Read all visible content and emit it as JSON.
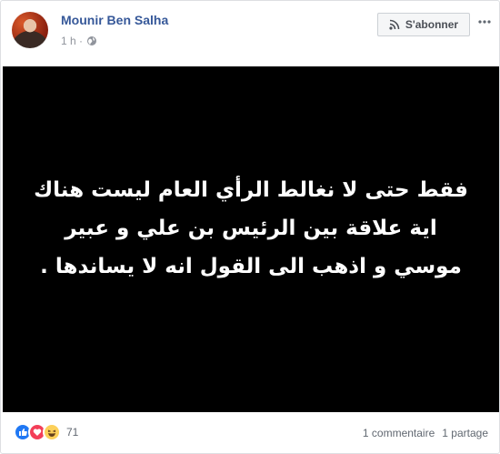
{
  "post": {
    "author": "Mounir Ben Salha",
    "time": "1 h ·",
    "subscribe_label": "S'abonner",
    "image_text": "فقط حتى لا نغالط الرأي العام ليست هناك اية علاقة بين الرئيس بن علي و عبير موسي و اذهب الى القول انه لا يساندها ."
  },
  "footer": {
    "reactions": [
      "like-icon",
      "love-icon",
      "haha-icon"
    ],
    "reaction_count": "71",
    "comments": "1 commentaire",
    "shares": "1 partage"
  },
  "colors": {
    "author_link": "#365899",
    "like": "#2078f4",
    "love": "#f33e58",
    "haha": "#fcd05a",
    "image_bg": "#000000"
  }
}
